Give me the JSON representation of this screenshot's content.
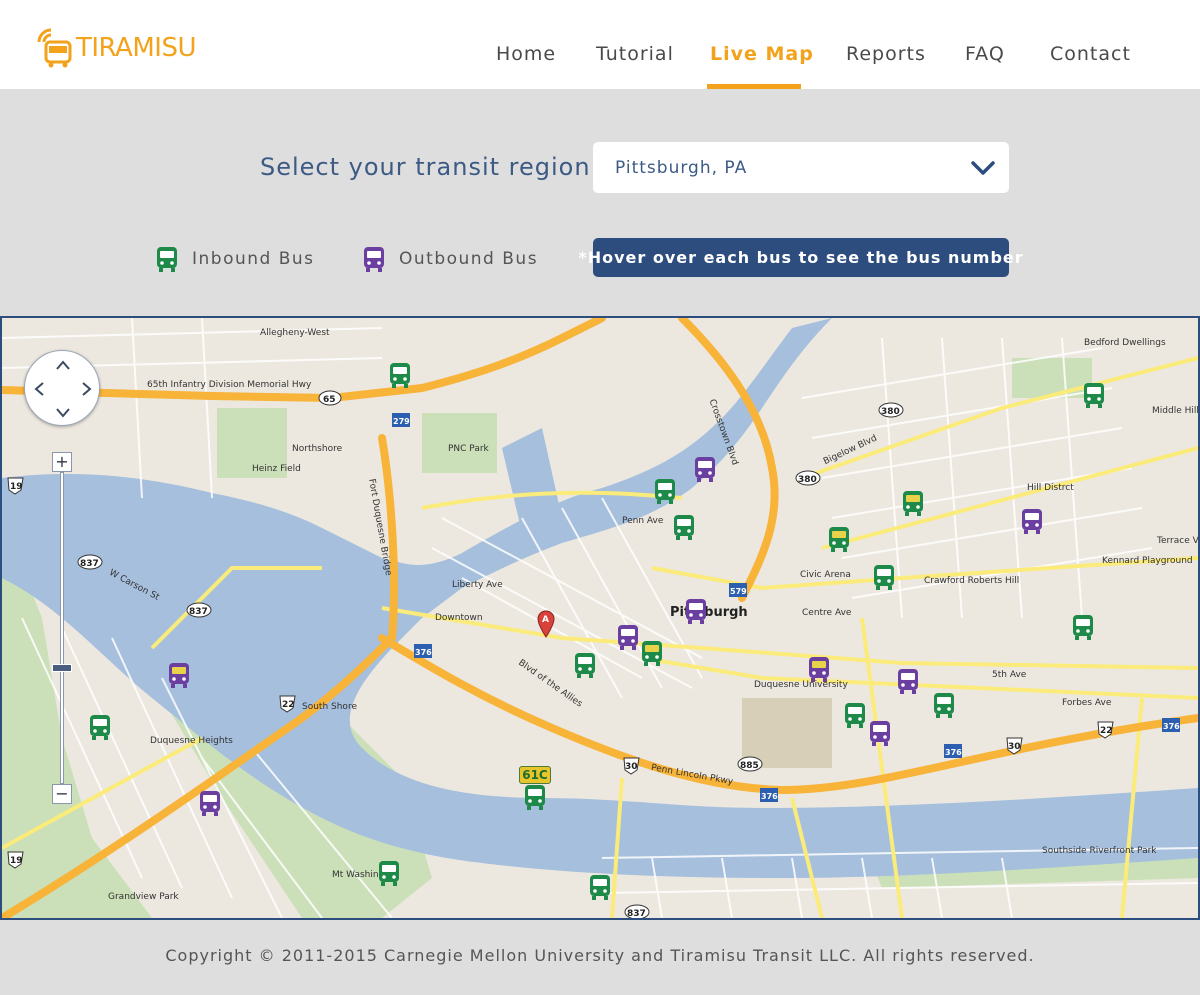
{
  "brand": {
    "name": "TIRAMISU"
  },
  "nav": {
    "items": [
      {
        "label": "Home",
        "active": false
      },
      {
        "label": "Tutorial",
        "active": false
      },
      {
        "label": "Live Map",
        "active": true
      },
      {
        "label": "Reports",
        "active": false
      },
      {
        "label": "FAQ",
        "active": false
      },
      {
        "label": "Contact",
        "active": false
      }
    ]
  },
  "region": {
    "label": "Select your transit region",
    "selected": "Pittsburgh, PA"
  },
  "legend": {
    "inbound": "Inbound Bus",
    "outbound": "Outbound Bus",
    "hover_note": "*Hover over each bus to see the bus number"
  },
  "map": {
    "labels": {
      "pittsburgh": "Pittsburgh",
      "hill_district": "Hill Distrct",
      "northshore": "Northshore",
      "downtown": "Downtown",
      "south_shore": "South Shore",
      "duquesne_heights": "Duquesne Heights",
      "allegheny_west": "Allegheny-West",
      "middle_hill": "Middle Hill",
      "crawford_roberts": "Crawford Roberts Hill",
      "pnc_park": "PNC Park",
      "heinz_field": "Heinz Field",
      "civic_arena": "Civic Arena",
      "bedford_dwellings": "Bedford Dwellings",
      "duquesne_university": "Duquesne University",
      "mt_washington": "Mt Washin",
      "strip_district_penn": "Penn Ave",
      "blvd_allies": "Blvd of the Allies",
      "penn_lincoln": "Penn Lincoln Pkwy",
      "carson_st": "W Carson St",
      "fort_duquesne_bridge": "Fort Duquesne Bridge",
      "crosstown_blvd": "Crosstown Blvd",
      "hwy_65": "65th Infantry Division Memorial Hwy",
      "bigelow_blvd": "Bigelow Blvd",
      "centre_ave": "Centre Ave",
      "fifth_ave": "5th Ave",
      "forbes_ave": "Forbes Ave",
      "liberty_ave": "Liberty Ave",
      "grandview_park": "Grandview Park",
      "terrace_village": "Terrace Village",
      "kennard_playground": "Kennard Playground",
      "southside_park": "Southside Riverfront Park"
    },
    "route_badge": "61C",
    "zoom_in": "+",
    "zoom_out": "−",
    "zoom_level": 0.63,
    "colors": {
      "inbound": "#1e8a4a",
      "outbound": "#6b3fa0",
      "water": "#a5bfdd",
      "park": "#cbe0b8",
      "highway": "#f8b339",
      "major_road": "#fbeb7b",
      "accent": "#f2a21b",
      "navy": "#2d4d7e"
    }
  },
  "footer": {
    "copyright": "Copyright © 2011-2015 Carnegie Mellon University and Tiramisu Transit LLC. All rights reserved."
  }
}
